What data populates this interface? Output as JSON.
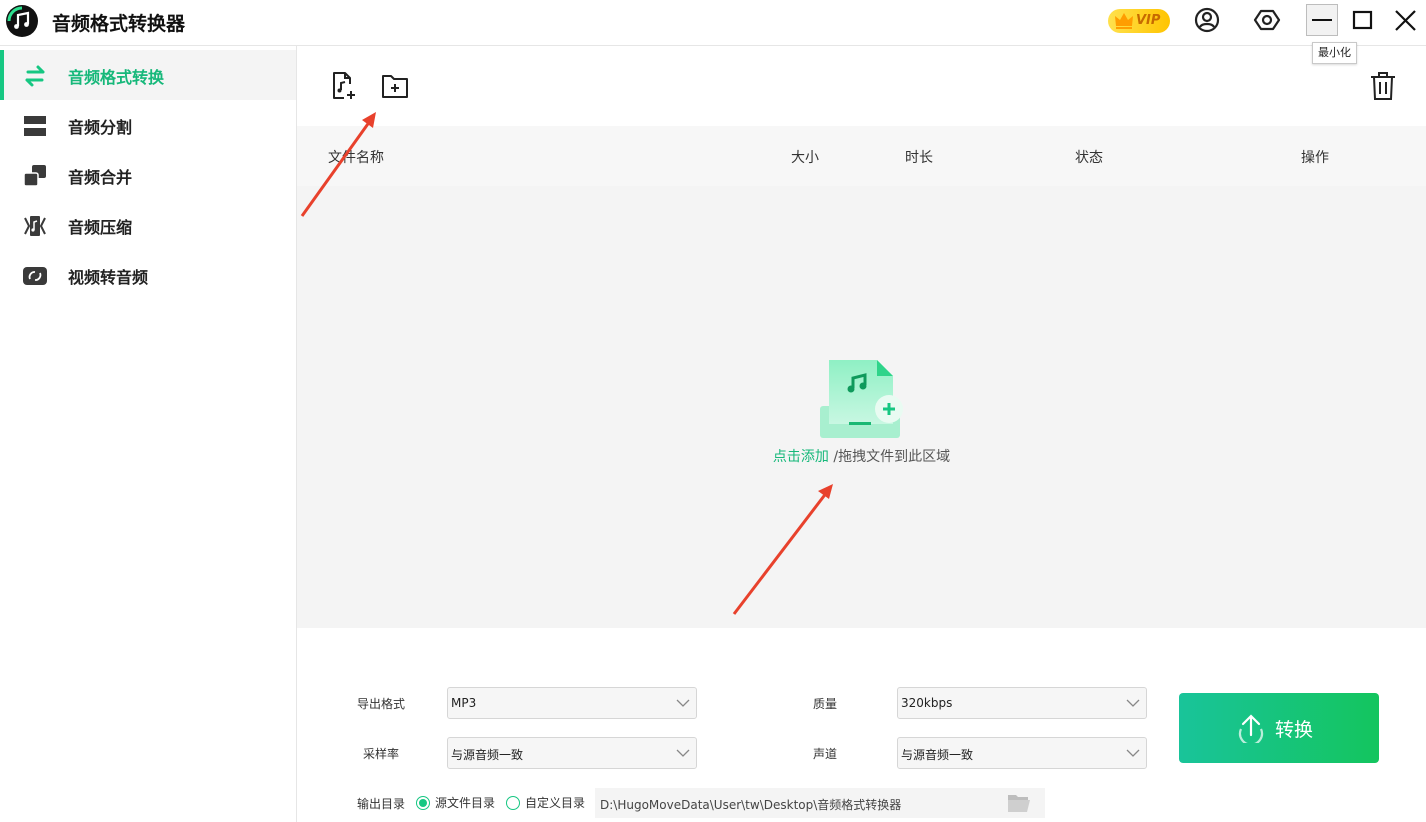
{
  "window": {
    "title": "音频格式转换器"
  },
  "titlebar": {
    "vip_label": "VIP",
    "tooltip": "最小化",
    "buttons": [
      "account-icon",
      "settings-icon",
      "minimize-icon",
      "maximize-icon",
      "close-icon"
    ]
  },
  "sidebar": {
    "items": [
      {
        "label": "音频格式转换",
        "icon": "swap-arrows-icon",
        "active": true
      },
      {
        "label": "音频分割",
        "icon": "split-icon",
        "active": false
      },
      {
        "label": "音频合并",
        "icon": "merge-icon",
        "active": false
      },
      {
        "label": "音频压缩",
        "icon": "compress-icon",
        "active": false
      },
      {
        "label": "视频转音频",
        "icon": "video-to-audio-icon",
        "active": false
      }
    ]
  },
  "toolbar": {
    "add_file_icon": "add-audio-file-icon",
    "add_folder_icon": "add-folder-icon",
    "delete_icon": "trash-icon"
  },
  "table": {
    "columns": [
      "文件名称",
      "大小",
      "时长",
      "状态",
      "操作"
    ]
  },
  "dropzone": {
    "link_text": "点击添加",
    "hint_text": "/拖拽文件到此区域"
  },
  "settings": {
    "format_label": "导出格式",
    "format_value": "MP3",
    "quality_label": "质量",
    "quality_value": "320kbps",
    "samplerate_label": "采样率",
    "samplerate_value": "与源音频一致",
    "channel_label": "声道",
    "channel_value": "与源音频一致",
    "output_label": "输出目录",
    "output_source_label": "源文件目录",
    "output_custom_label": "自定义目录",
    "output_path": "D:\\HugoMoveData\\User\\tw\\Desktop\\音频格式转换器"
  },
  "convert": {
    "label": "转换"
  },
  "colors": {
    "accent": "#16c782",
    "annotation_arrow": "#e8412c"
  }
}
